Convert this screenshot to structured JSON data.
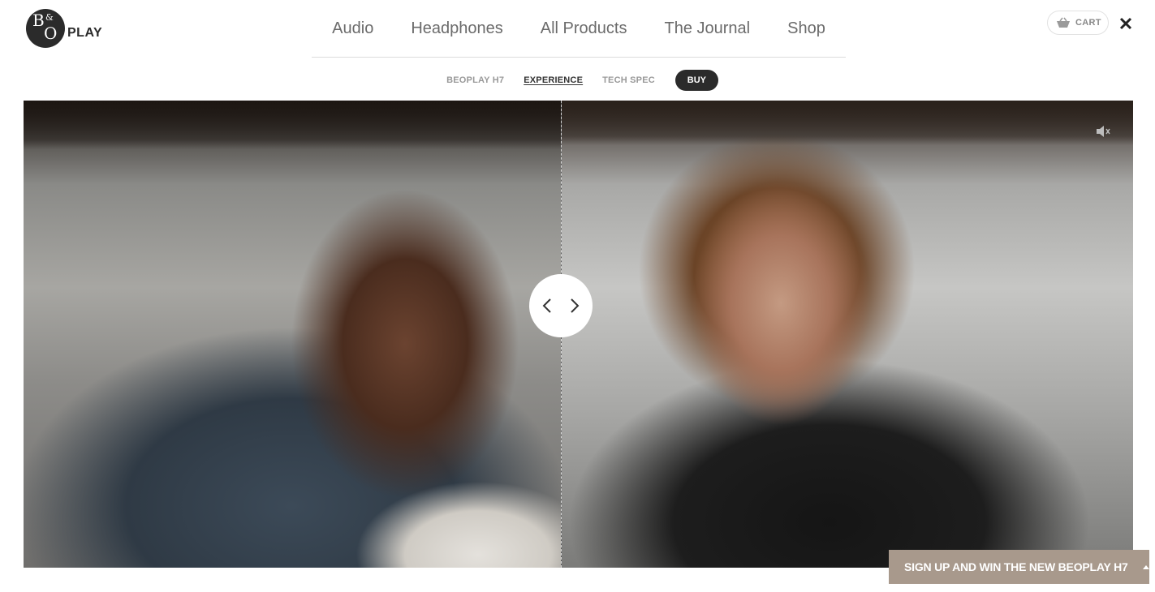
{
  "header": {
    "logo": {
      "mark": "B&O",
      "wordmark": "PLAY"
    },
    "nav": [
      {
        "label": "Audio"
      },
      {
        "label": "Headphones"
      },
      {
        "label": "All Products"
      },
      {
        "label": "The Journal"
      },
      {
        "label": "Shop"
      }
    ],
    "cart_label": "CART",
    "cart_icon": "basket-icon",
    "close_icon": "close-icon"
  },
  "sub_nav": {
    "items": [
      {
        "label": "BEOPLAY H7",
        "active": false
      },
      {
        "label": "EXPERIENCE",
        "active": true
      },
      {
        "label": "TECH SPEC",
        "active": false
      }
    ],
    "buy_label": "BUY"
  },
  "video": {
    "handle_left_icon": "chevron-left-icon",
    "handle_right_icon": "chevron-right-icon",
    "mute_icon": "speaker-mute-icon"
  },
  "signup": {
    "label": "SIGN UP AND WIN THE NEW BEOPLAY H7",
    "icon": "caret-up-icon",
    "background": "#a8998c"
  },
  "colors": {
    "accent_dark": "#2b2b2b",
    "nav_text": "#6b6b6b",
    "subnav_text": "#999999"
  }
}
